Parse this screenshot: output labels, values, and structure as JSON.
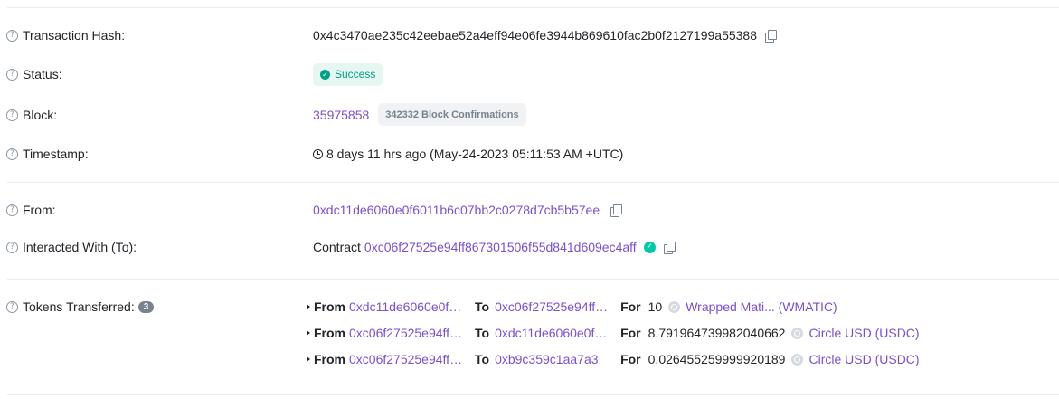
{
  "rows": {
    "tx_hash": {
      "label": "Transaction Hash:",
      "value": "0x4c3470ae235c42eebae52a4eff94e06fe3944b869610fac2b0f2127199a55388"
    },
    "status": {
      "label": "Status:",
      "value": "Success"
    },
    "block": {
      "label": "Block:",
      "value": "35975858",
      "confirmations": "342332 Block Confirmations"
    },
    "timestamp": {
      "label": "Timestamp:",
      "value": "8 days 11 hrs ago (May-24-2023 05:11:53 AM +UTC)"
    },
    "from": {
      "label": "From:",
      "value": "0xdc11de6060e0f6011b6c07bb2c0278d7cb5b57ee"
    },
    "interacted": {
      "label": "Interacted With (To):",
      "prefix": "Contract",
      "value": "0xc06f27525e94ff867301506f55d841d609ec4aff"
    },
    "tokens": {
      "label": "Tokens Transferred:",
      "count": "3"
    }
  },
  "transfers": [
    {
      "from_kw": "From",
      "from": "0xdc11de6060e0f6011b6c07bb2c0278d7cb5b57ee",
      "to_kw": "To",
      "to": "0xc06f27525e94ff867301506f55d841d609ec4aff",
      "for_kw": "For",
      "amount": "10",
      "token": "Wrapped Mati... (WMATIC)"
    },
    {
      "from_kw": "From",
      "from": "0xc06f27525e94ff867301506f55d841d609ec4aff",
      "to_kw": "To",
      "to": "0xdc11de6060e0f6011b6c07bb2c0278d7cb5b57ee",
      "for_kw": "For",
      "amount": "8.791964739982040662",
      "token": "Circle USD (USDC)"
    },
    {
      "from_kw": "From",
      "from": "0xc06f27525e94ff867301506f55d841d609ec4aff",
      "to_kw": "To",
      "to": "0xb9c359c1aa7a3",
      "for_kw": "For",
      "amount": "0.026455259999920189",
      "token": "Circle USD (USDC)"
    }
  ],
  "icons": {
    "help": "question-circle-icon",
    "copy": "copy-icon",
    "check": "check-circle-icon",
    "clock": "clock-icon",
    "token": "token-logo-icon"
  },
  "colors": {
    "link": "#7b4fd0",
    "success": "#00a186",
    "success_bg": "#e6f7f2",
    "muted": "#77838f"
  }
}
